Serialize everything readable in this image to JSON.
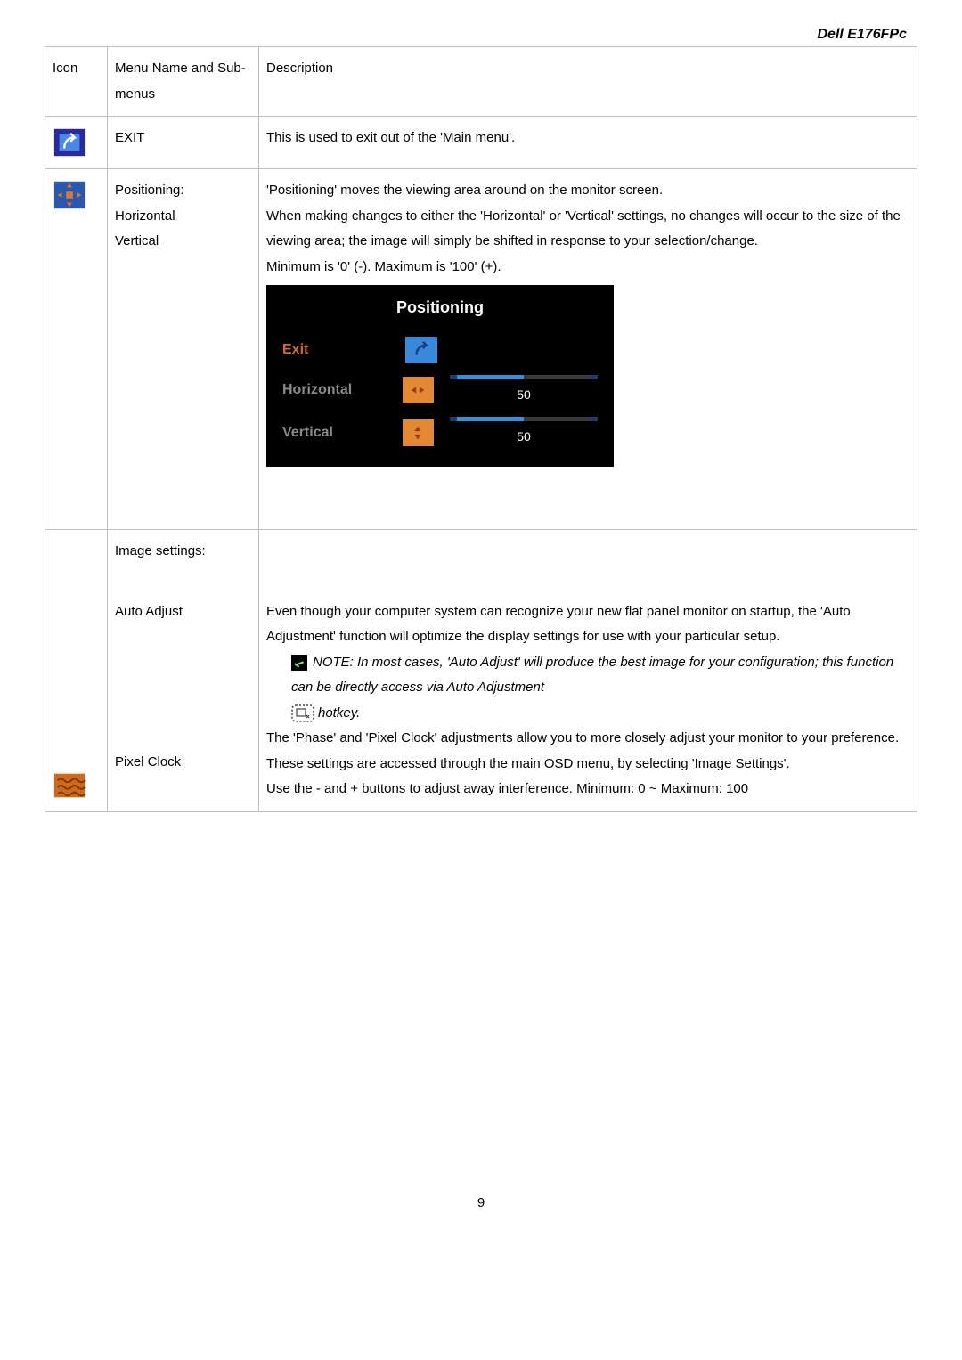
{
  "header": {
    "product": "Dell E176FPc"
  },
  "columns": {
    "icon": "Icon",
    "menu": "Menu Name and Sub-menus",
    "desc": "Description"
  },
  "rows": {
    "exit": {
      "menu": "EXIT",
      "desc": "This is used to exit out of the 'Main menu'."
    },
    "positioning": {
      "menu_lines": [
        "Positioning:",
        "Horizontal",
        "Vertical"
      ],
      "desc_lines": [
        "'Positioning' moves the viewing area around on the monitor screen.",
        "When making changes to either the 'Horizontal' or 'Vertical' settings, no changes will occur to the size of the viewing area; the image will simply be shifted in response to your selection/change.",
        "Minimum is '0' (-). Maximum is '100' (+)."
      ],
      "osd": {
        "title": "Positioning",
        "exit_label": "Exit",
        "horizontal_label": "Horizontal",
        "vertical_label": "Vertical",
        "horizontal_value": "50",
        "vertical_value": "50"
      }
    },
    "image_settings": {
      "menu_heading": "Image settings:",
      "auto_adjust_label": "Auto Adjust",
      "auto_adjust_desc": "Even though your computer system can recognize your new flat panel monitor on startup, the 'Auto Adjustment' function will optimize the display settings for use with your particular setup.",
      "note1": "NOTE: In most cases, 'Auto Adjust' will produce the best image for your configuration; this function can be directly access via Auto Adjustment",
      "note2_suffix": "hotkey.",
      "pixel_clock_label": "Pixel Clock",
      "pixel_clock_desc1": "The 'Phase' and 'Pixel Clock' adjustments allow you to more closely adjust your monitor to your preference. These settings are accessed through the main OSD menu, by selecting 'Image Settings'.",
      "pixel_clock_desc2": "Use the - and + buttons to adjust away interference. Minimum: 0 ~ Maximum: 100"
    }
  },
  "page_number": "9"
}
